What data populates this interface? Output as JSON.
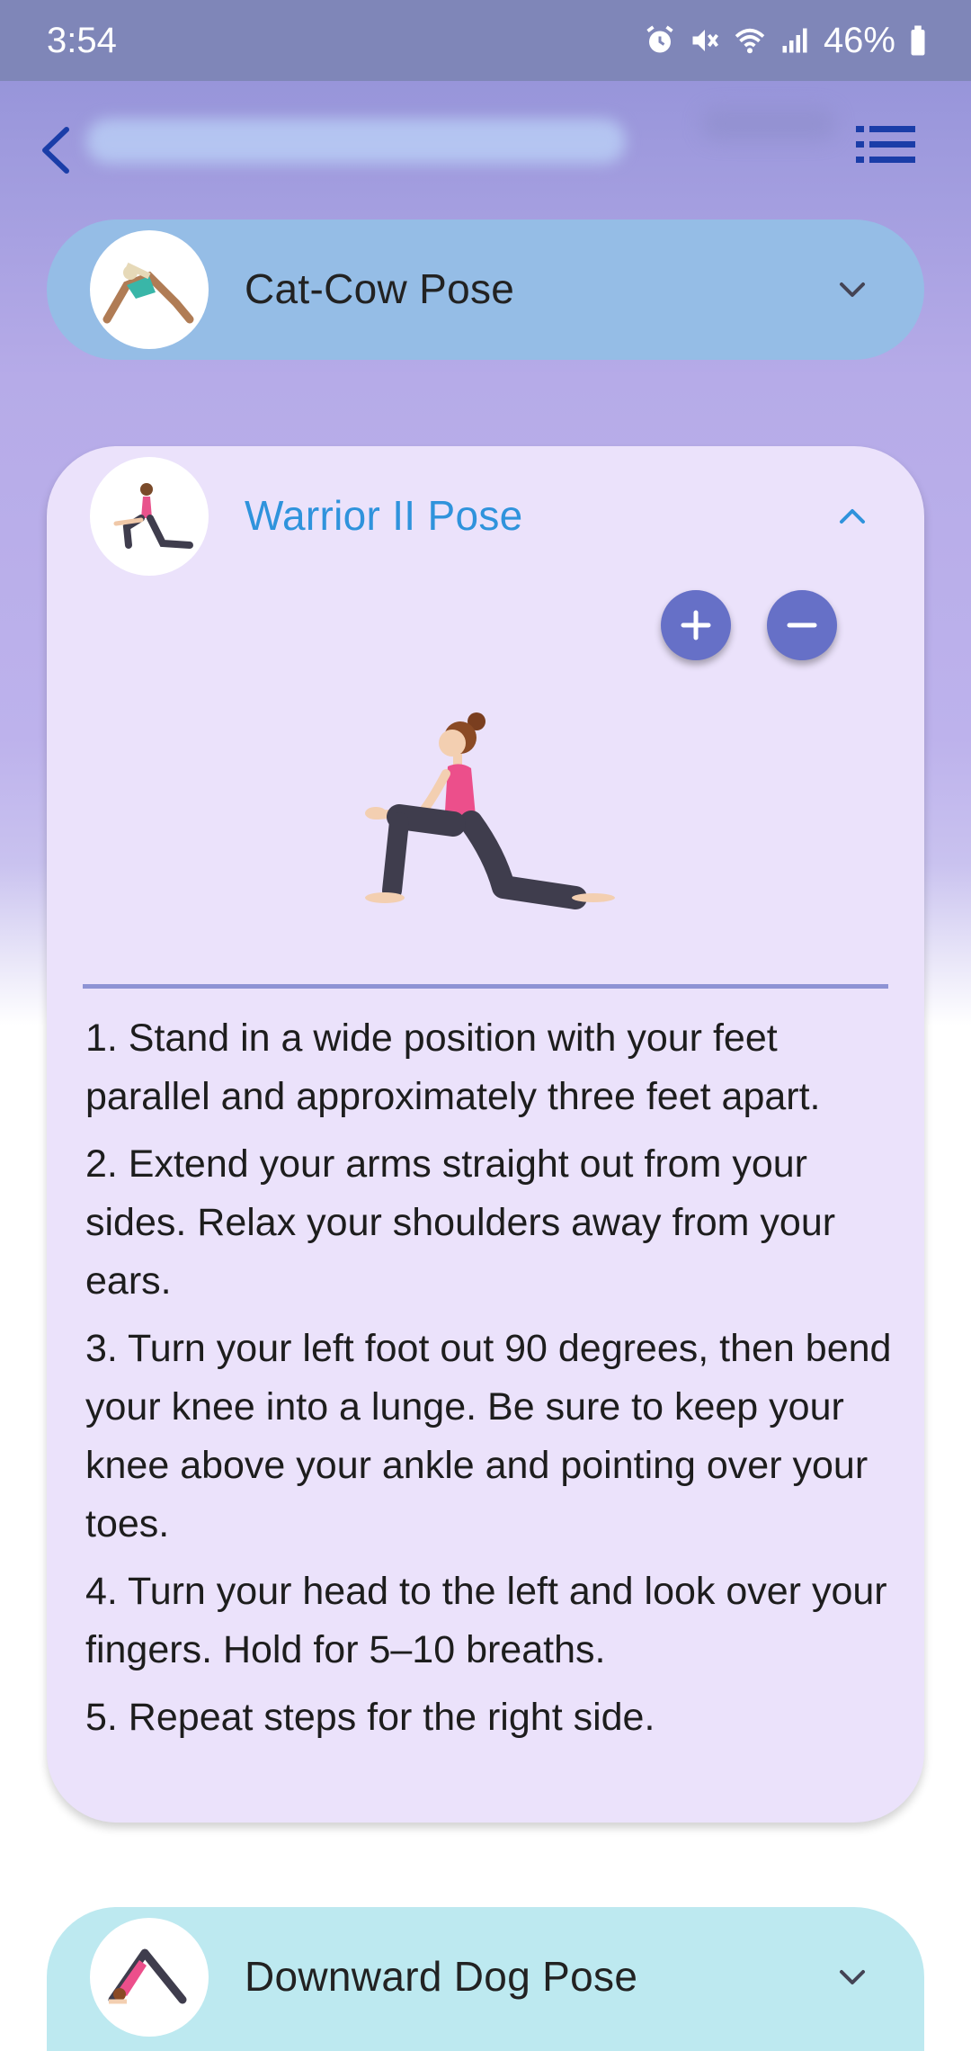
{
  "status_bar": {
    "time": "3:54",
    "battery": "46%",
    "icons": [
      "alarm-icon",
      "mute-icon",
      "wifi-icon",
      "signal-icon",
      "battery-icon"
    ]
  },
  "top_bar": {
    "back_icon": "chevron-left-icon",
    "menu_icon": "list-icon"
  },
  "poses": [
    {
      "title": "Cat-Cow Pose",
      "expanded": false
    },
    {
      "title": "Warrior II Pose",
      "expanded": true
    },
    {
      "title": "Downward Dog Pose",
      "expanded": false
    }
  ],
  "controls": {
    "zoom_in_icon": "plus-icon",
    "zoom_out_icon": "minus-icon"
  },
  "steps": [
    "1. Stand in a wide position with your feet parallel and approximately three feet apart.",
    "2. Extend your arms straight out from your sides. Relax your shoulders away from your ears.",
    "3. Turn your left foot out 90 degrees, then bend your knee into a lunge. Be sure to keep your knee above your ankle and pointing over your toes.",
    "4. Turn your head to the left and look over your fingers. Hold for 5–10 breaths.",
    "5. Repeat steps for the right side."
  ],
  "colors": {
    "accent": "#2f93dc",
    "button": "#6670c7",
    "nav_icon": "#1a3da8"
  }
}
